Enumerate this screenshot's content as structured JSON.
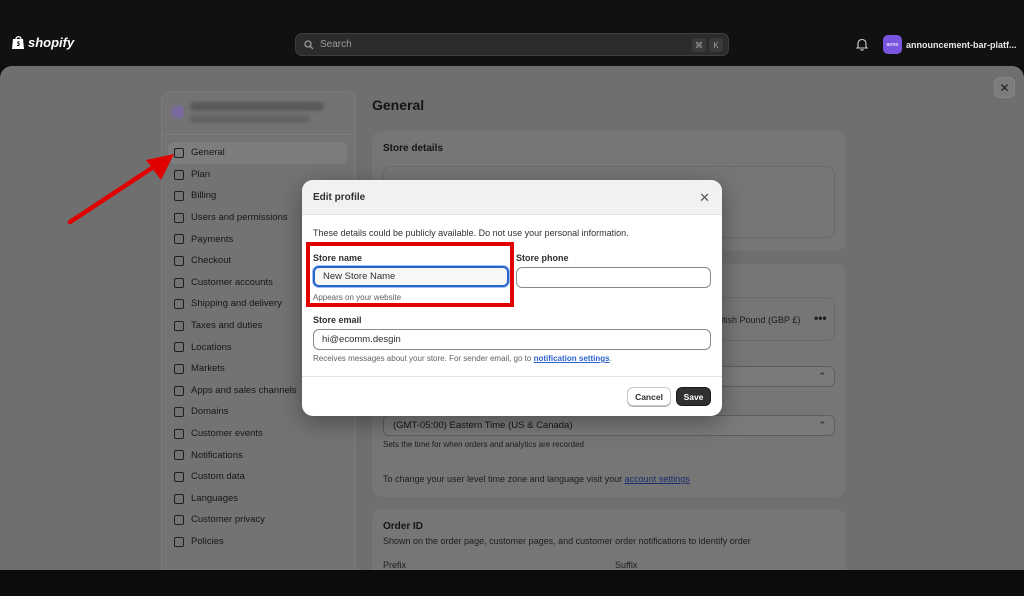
{
  "topbar": {
    "brand": "shopify",
    "search_placeholder": "Search",
    "shortcut_keys": [
      "⌘",
      "K"
    ],
    "store_avatar_text": "anno",
    "store_name": "announcement-bar-platf..."
  },
  "settings": {
    "close_label": "✕",
    "page_title": "General",
    "sidebar": {
      "items": [
        {
          "label": "General",
          "active": true
        },
        {
          "label": "Plan"
        },
        {
          "label": "Billing"
        },
        {
          "label": "Users and permissions"
        },
        {
          "label": "Payments"
        },
        {
          "label": "Checkout"
        },
        {
          "label": "Customer accounts"
        },
        {
          "label": "Shipping and delivery"
        },
        {
          "label": "Taxes and duties"
        },
        {
          "label": "Locations"
        },
        {
          "label": "Markets"
        },
        {
          "label": "Apps and sales channels"
        },
        {
          "label": "Domains"
        },
        {
          "label": "Customer events"
        },
        {
          "label": "Notifications"
        },
        {
          "label": "Custom data"
        },
        {
          "label": "Languages"
        },
        {
          "label": "Customer privacy"
        },
        {
          "label": "Policies"
        }
      ]
    },
    "store_details_title": "Store details",
    "currency_fragment": "ritish Pound (GBP £)",
    "timezone_value": "(GMT-05:00) Eastern Time (US & Canada)",
    "timezone_help": "Sets the time for when orders and analytics are recorded",
    "account_settings_text": "To change your user level time zone and language visit your",
    "account_settings_link": "account settings",
    "order_id": {
      "title": "Order ID",
      "description": "Shown on the order page, customer pages, and customer order notifications to identify order",
      "prefix_label": "Prefix",
      "suffix_label": "Suffix"
    }
  },
  "modal": {
    "title": "Edit profile",
    "close_label": "✕",
    "note": "These details could be publicly available. Do not use your personal information.",
    "store_name": {
      "label": "Store name",
      "value": "New Store Name",
      "help": "Appears on your website"
    },
    "store_phone": {
      "label": "Store phone",
      "value": ""
    },
    "store_email": {
      "label": "Store email",
      "value": "hi@ecomm.desgin",
      "help_text": "Receives messages about your store. For sender email, go to",
      "help_link": "notification settings",
      "help_end": "."
    },
    "cancel_label": "Cancel",
    "save_label": "Save"
  },
  "colors": {
    "annotation": "#e00000",
    "focus": "#2b63cc"
  }
}
